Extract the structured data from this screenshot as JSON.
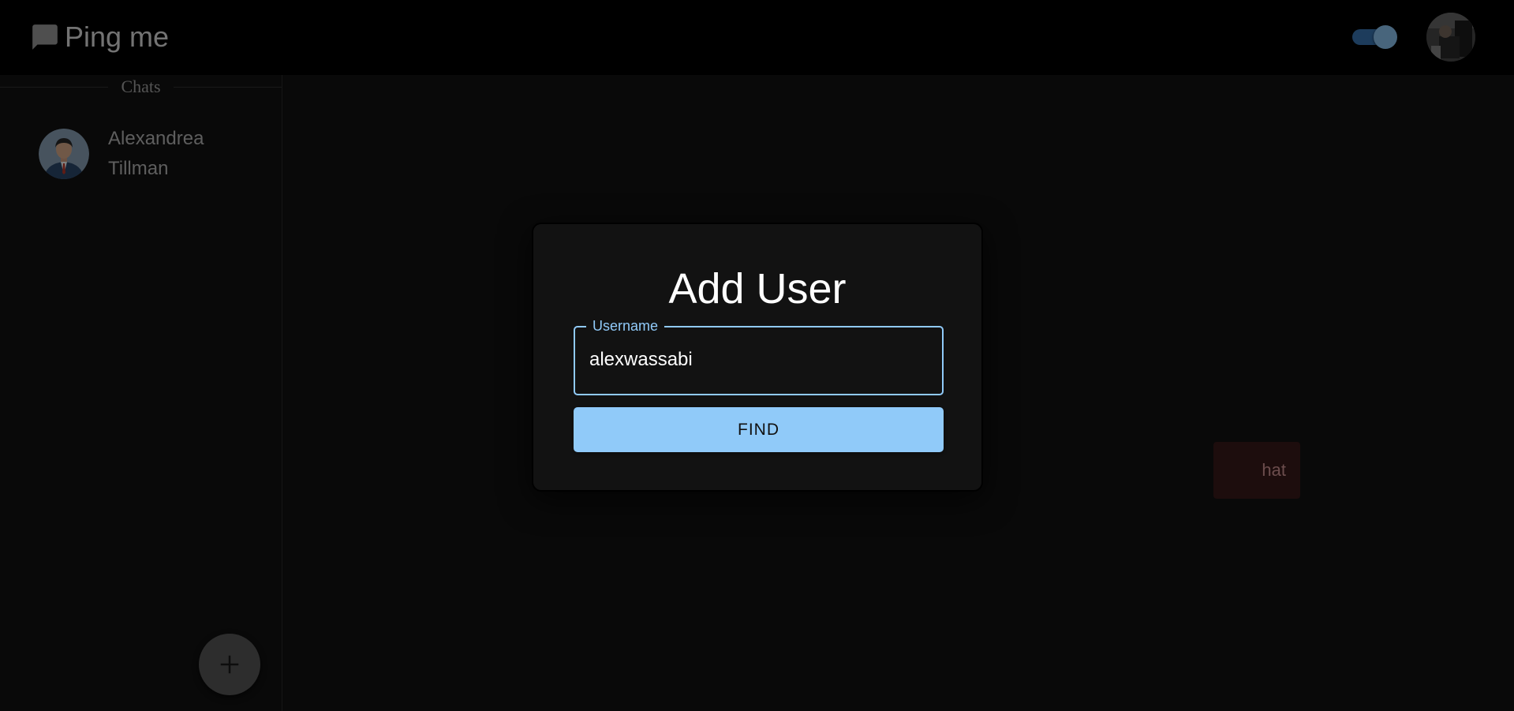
{
  "app": {
    "title": "Ping me",
    "theme_toggle_on": true
  },
  "sidebar": {
    "section_title": "Chats",
    "chats": [
      {
        "name": "Alexandrea Tillman"
      }
    ],
    "add_button_label": "+"
  },
  "main": {
    "hint_fragment": "hat"
  },
  "modal": {
    "title": "Add User",
    "username_label": "Username",
    "username_value": "alexwassabi",
    "find_label": "FIND"
  },
  "colors": {
    "accent": "#90caf9",
    "header_bg": "#000000",
    "surface": "#121212"
  },
  "icons": {
    "brand": "chat-bubble-icon",
    "add": "plus-icon"
  }
}
